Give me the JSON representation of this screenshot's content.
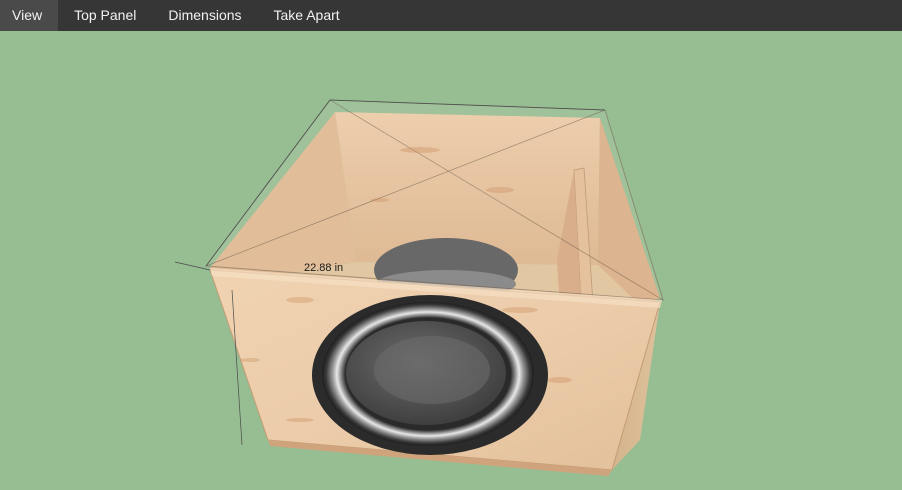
{
  "menu": {
    "items": [
      {
        "label": "View"
      },
      {
        "label": "Top Panel"
      },
      {
        "label": "Dimensions"
      },
      {
        "label": "Take Apart"
      }
    ]
  },
  "scene": {
    "background_color": "#97bd93",
    "wood_color": "#e9c9a4",
    "dimensions": {
      "width_label": "22.88 in"
    }
  }
}
